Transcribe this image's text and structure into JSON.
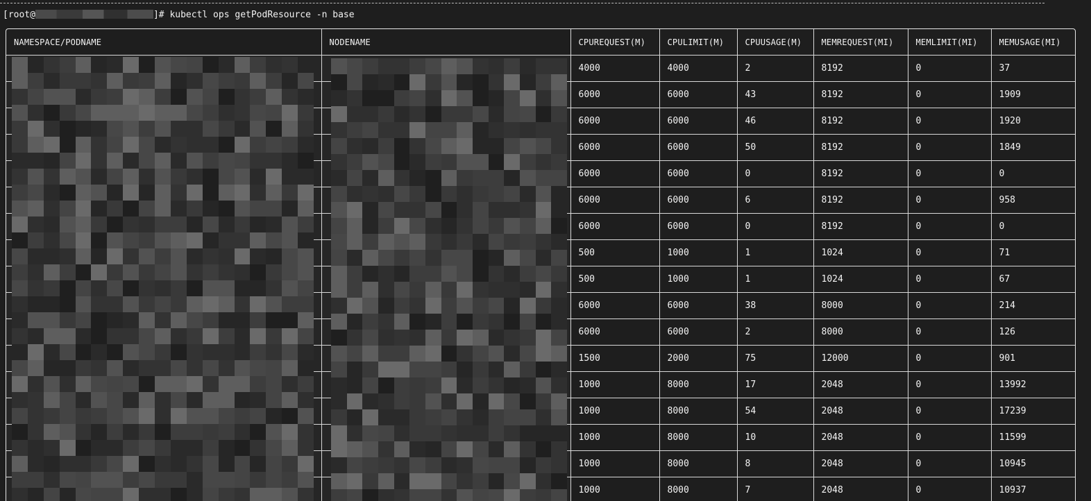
{
  "terminal": {
    "prompt_prefix": "[root@",
    "prompt_suffix": "]# kubectl ops getPodResource -n base"
  },
  "table": {
    "columns": [
      "NAMESPACE/PODNAME",
      "NODENAME",
      "CPUREQUEST(M)",
      "CPULIMIT(M)",
      "CPUUSAGE(M)",
      "MEMREQUEST(MI)",
      "MEMLIMIT(MI)",
      "MEMUSAGE(MI)"
    ],
    "rows": [
      [
        "",
        "",
        "4000",
        "4000",
        "2",
        "8192",
        "0",
        "37"
      ],
      [
        "",
        "",
        "6000",
        "6000",
        "43",
        "8192",
        "0",
        "1909"
      ],
      [
        "",
        "",
        "6000",
        "6000",
        "46",
        "8192",
        "0",
        "1920"
      ],
      [
        "",
        "",
        "6000",
        "6000",
        "50",
        "8192",
        "0",
        "1849"
      ],
      [
        "",
        "",
        "6000",
        "6000",
        "0",
        "8192",
        "0",
        "0"
      ],
      [
        "",
        "",
        "6000",
        "6000",
        "6",
        "8192",
        "0",
        "958"
      ],
      [
        "",
        "",
        "6000",
        "6000",
        "0",
        "8192",
        "0",
        "0"
      ],
      [
        "",
        "",
        "500",
        "1000",
        "1",
        "1024",
        "0",
        "71"
      ],
      [
        "",
        "",
        "500",
        "1000",
        "1",
        "1024",
        "0",
        "67"
      ],
      [
        "",
        "",
        "6000",
        "6000",
        "38",
        "8000",
        "0",
        "214"
      ],
      [
        "",
        "",
        "6000",
        "6000",
        "2",
        "8000",
        "0",
        "126"
      ],
      [
        "",
        "",
        "1500",
        "2000",
        "75",
        "12000",
        "0",
        "901"
      ],
      [
        "",
        "",
        "1000",
        "8000",
        "17",
        "2048",
        "0",
        "13992"
      ],
      [
        "",
        "",
        "1000",
        "8000",
        "54",
        "2048",
        "0",
        "17239"
      ],
      [
        "",
        "",
        "1000",
        "8000",
        "10",
        "2048",
        "0",
        "11599"
      ],
      [
        "",
        "",
        "1000",
        "8000",
        "8",
        "2048",
        "0",
        "10945"
      ],
      [
        "",
        "",
        "1000",
        "8000",
        "7",
        "2048",
        "0",
        "10937"
      ]
    ]
  },
  "colors": {
    "background": "#1e1e1e",
    "text": "#f2f2f2",
    "grid": "#d9d9d9"
  }
}
